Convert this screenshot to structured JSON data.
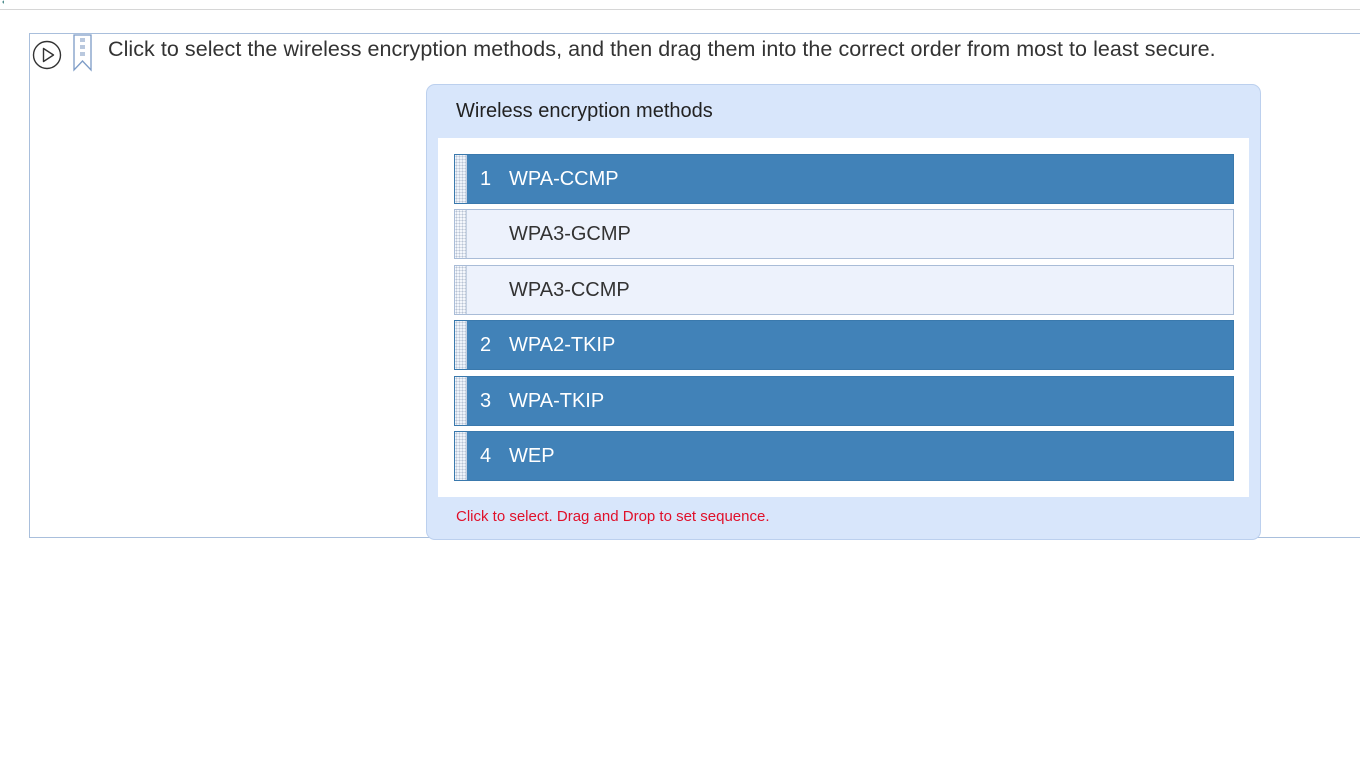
{
  "question": {
    "text": "Click to select the wireless encryption methods, and then drag them into the correct order from most to least secure."
  },
  "icons": {
    "play": "play-circle-icon",
    "bookmark": "bookmark-icon"
  },
  "panel": {
    "title": "Wireless encryption methods",
    "hint": "Click to select. Drag and Drop to set sequence.",
    "items": [
      {
        "order": "1",
        "label": "WPA-CCMP",
        "selected": true
      },
      {
        "order": "",
        "label": "WPA3-GCMP",
        "selected": false
      },
      {
        "order": "",
        "label": "WPA3-CCMP",
        "selected": false
      },
      {
        "order": "2",
        "label": "WPA2-TKIP",
        "selected": true
      },
      {
        "order": "3",
        "label": "WPA-TKIP",
        "selected": true
      },
      {
        "order": "4",
        "label": "WEP",
        "selected": true
      }
    ]
  },
  "colors": {
    "selected_bg": "#4182b8",
    "unselected_bg": "#edf2fc",
    "panel_bg": "#d8e6fb",
    "hint_text": "#e0102a"
  }
}
